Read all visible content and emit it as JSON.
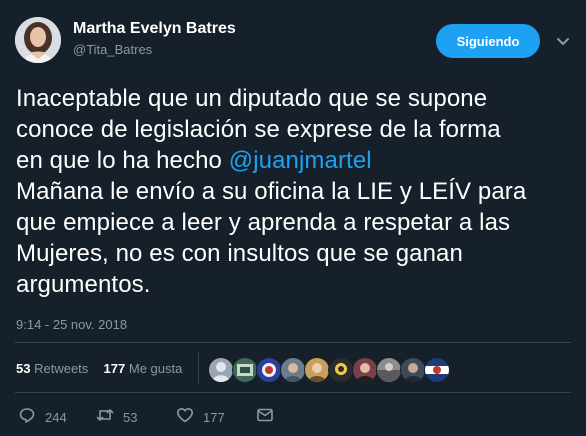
{
  "author": {
    "name": "Martha Evelyn Batres",
    "handle": "@Tita_Batres"
  },
  "follow_button": {
    "label": "Siguiendo"
  },
  "tweet": {
    "lines": [
      "Inaceptable que un diputado que se supone",
      "conoce de legislación se exprese de la forma",
      "en que lo ha hecho ",
      "Mañana le envío a su oficina la LIE y LEÍV para",
      "que empiece a leer y aprenda a respetar a las",
      "Mujeres, no es con insultos que se ganan",
      "argumentos."
    ],
    "mention": "@juanjmartel",
    "timestamp": "9:14 - 25 nov. 2018"
  },
  "stats": {
    "retweets_count": "53",
    "retweets_label": "Retweets",
    "likes_count": "177",
    "likes_label": "Me gusta"
  },
  "actions": {
    "reply_count": "244",
    "retweet_count": "53",
    "like_count": "177"
  },
  "icons": {
    "reply": "reply-icon",
    "retweet": "retweet-icon",
    "like": "heart-icon",
    "message": "envelope-icon",
    "caret": "chevron-down-icon"
  },
  "colors": {
    "background": "#15202b",
    "text": "#ffffff",
    "secondary": "#8899a6",
    "accent": "#1da1f2",
    "divider": "#38444d"
  }
}
